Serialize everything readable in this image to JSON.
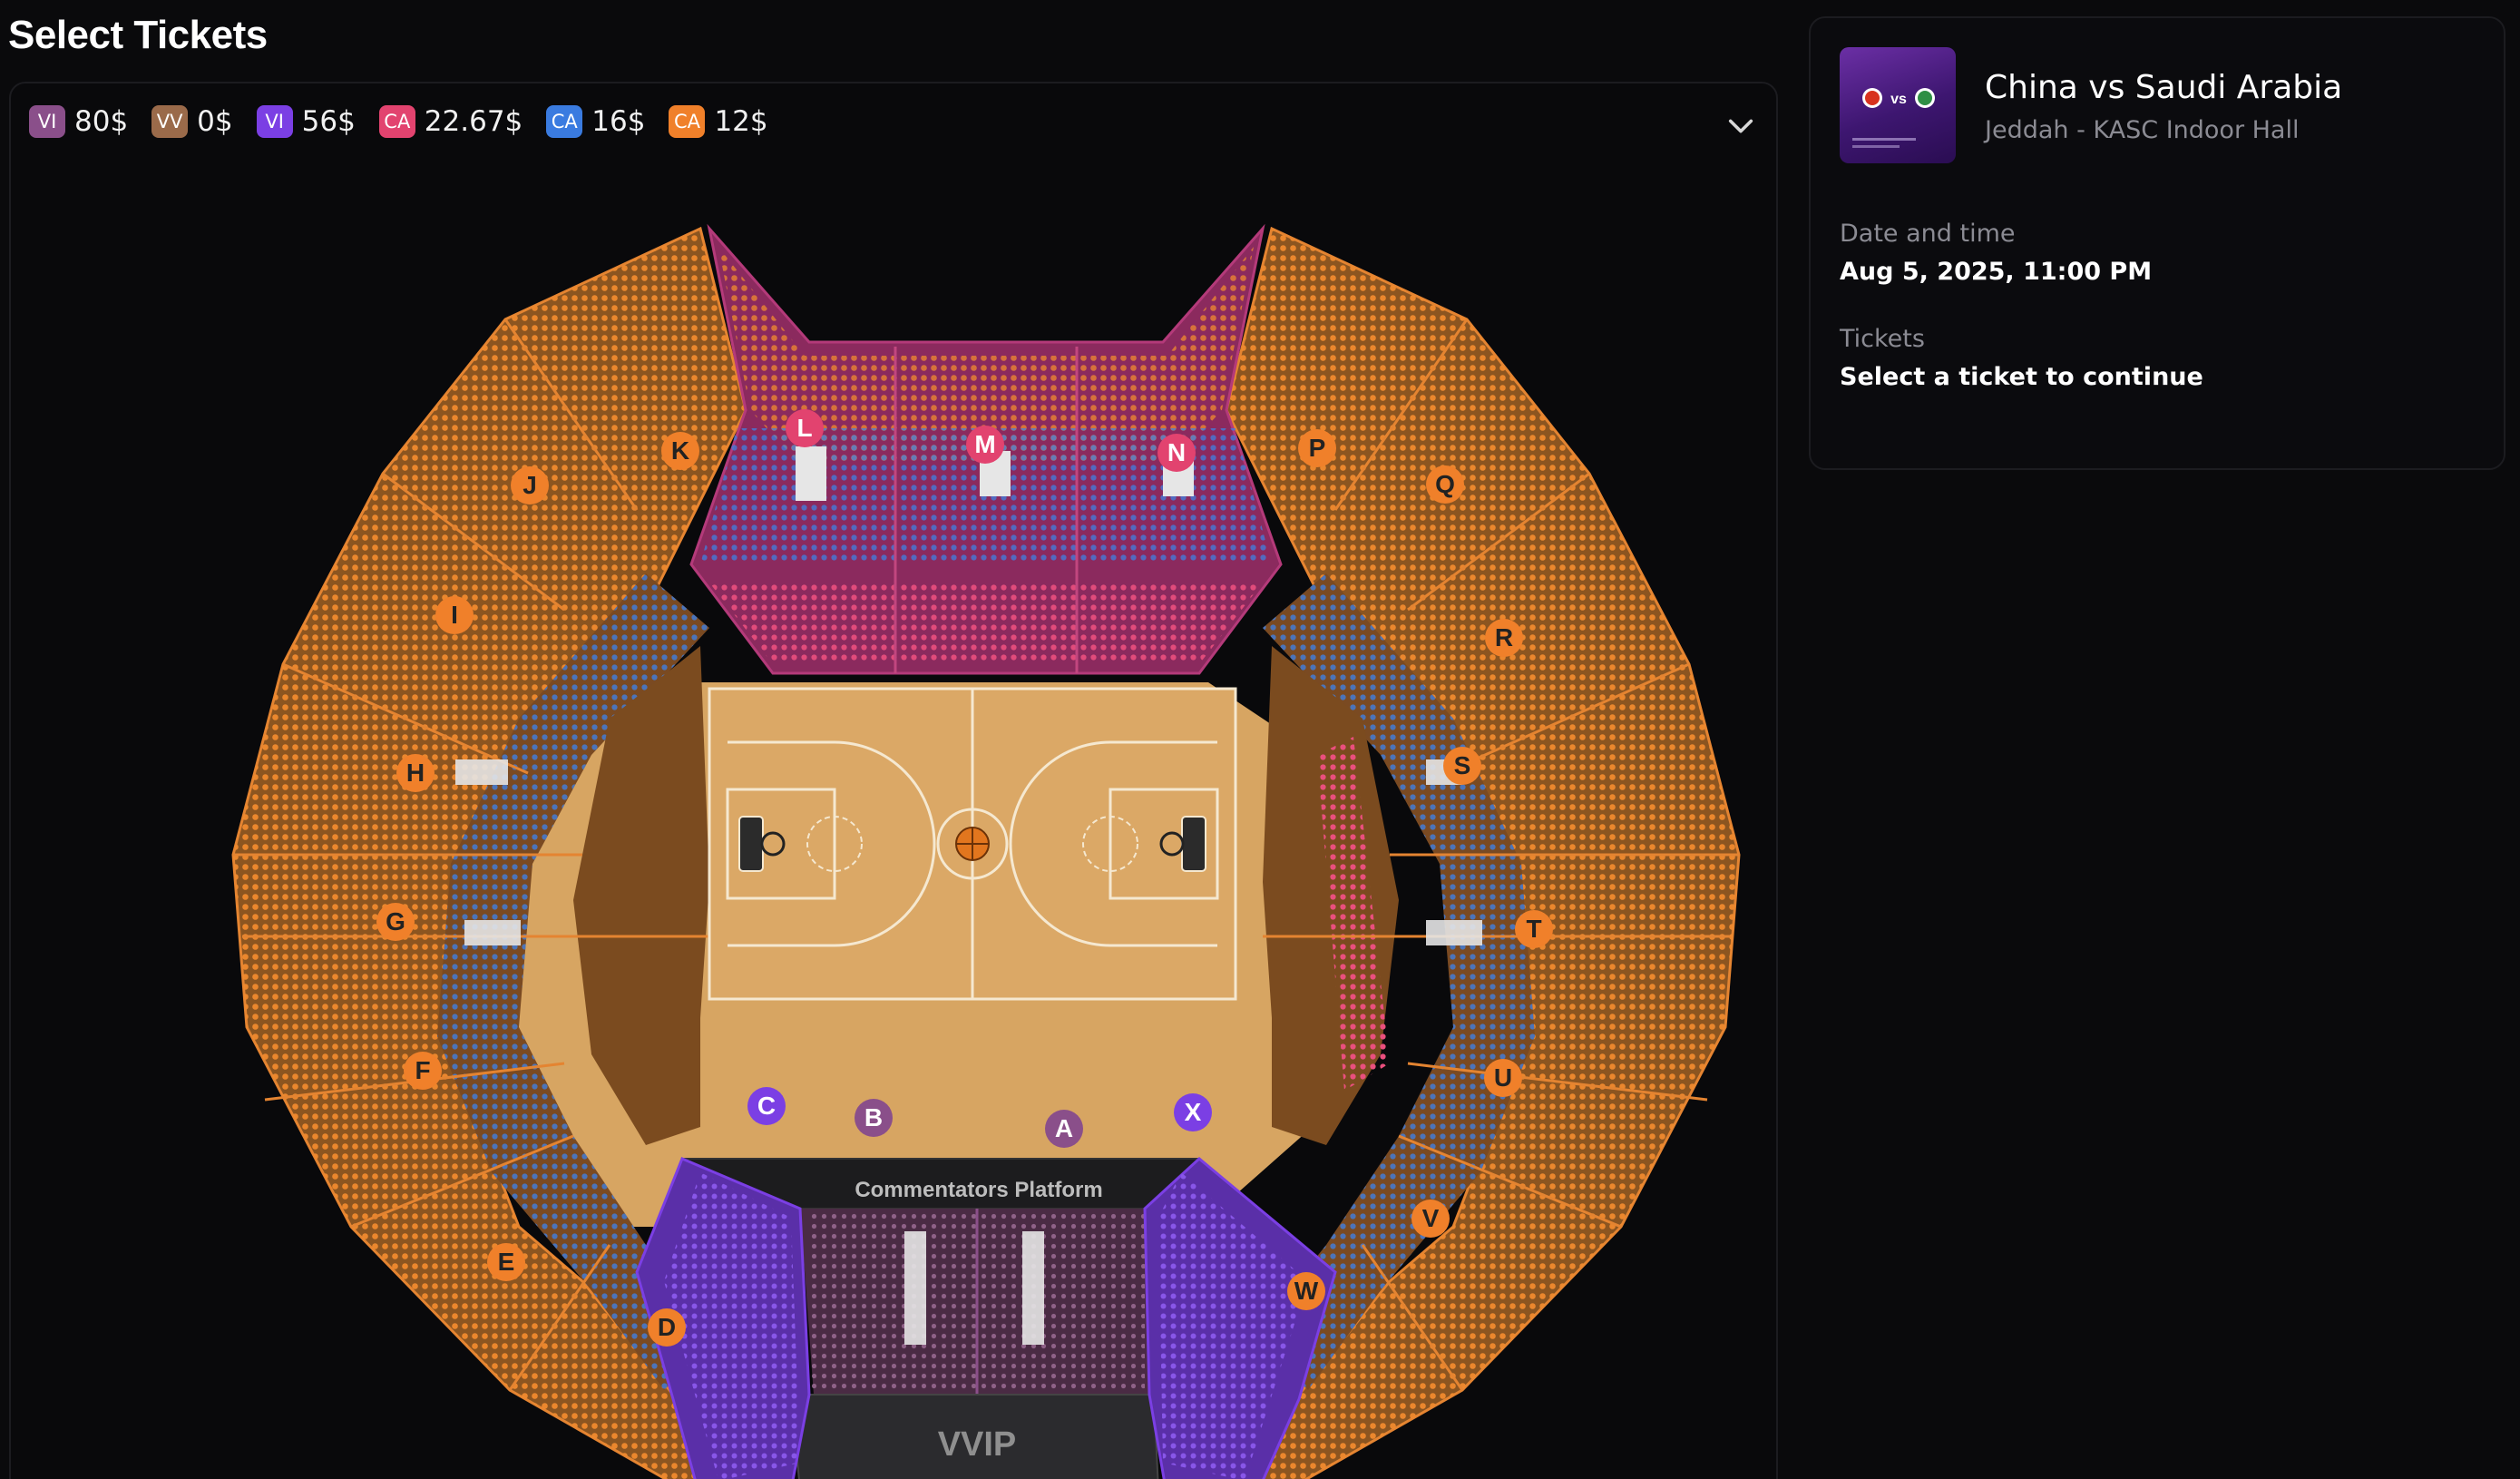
{
  "page": {
    "title": "Select Tickets"
  },
  "legend": [
    {
      "code": "VI",
      "price": "80$",
      "color": "#8a4f8a"
    },
    {
      "code": "VV",
      "price": "0$",
      "color": "#9a6a4a"
    },
    {
      "code": "VI",
      "price": "56$",
      "color": "#7b3fe4"
    },
    {
      "code": "CA",
      "price": "22.67$",
      "color": "#e2436f"
    },
    {
      "code": "CA",
      "price": "16$",
      "color": "#3a7be0"
    },
    {
      "code": "CA",
      "price": "12$",
      "color": "#f0802a"
    }
  ],
  "seat_map": {
    "sections": [
      {
        "label": "A",
        "color": "#8a4f8a"
      },
      {
        "label": "B",
        "color": "#8a4f8a"
      },
      {
        "label": "C",
        "color": "#7b3fe4"
      },
      {
        "label": "D",
        "color": "#f0802a"
      },
      {
        "label": "E",
        "color": "#f0802a"
      },
      {
        "label": "F",
        "color": "#f0802a"
      },
      {
        "label": "G",
        "color": "#f0802a"
      },
      {
        "label": "H",
        "color": "#f0802a"
      },
      {
        "label": "I",
        "color": "#f0802a"
      },
      {
        "label": "J",
        "color": "#f0802a"
      },
      {
        "label": "K",
        "color": "#f0802a"
      },
      {
        "label": "L",
        "color": "#e2436f"
      },
      {
        "label": "M",
        "color": "#e2436f"
      },
      {
        "label": "N",
        "color": "#e2436f"
      },
      {
        "label": "P",
        "color": "#f0802a"
      },
      {
        "label": "Q",
        "color": "#f0802a"
      },
      {
        "label": "R",
        "color": "#f0802a"
      },
      {
        "label": "S",
        "color": "#f0802a"
      },
      {
        "label": "T",
        "color": "#f0802a"
      },
      {
        "label": "U",
        "color": "#f0802a"
      },
      {
        "label": "V",
        "color": "#f0802a"
      },
      {
        "label": "W",
        "color": "#f0802a"
      },
      {
        "label": "X",
        "color": "#7b3fe4"
      }
    ],
    "commentators_label": "Commentators Platform",
    "vvip_label": "VVIP"
  },
  "event": {
    "title": "China vs Saudi Arabia",
    "venue": "Jeddah - KASC Indoor Hall",
    "date_label": "Date and time",
    "date_value": "Aug 5, 2025, 11:00 PM",
    "tickets_label": "Tickets",
    "tickets_value": "Select a ticket to continue",
    "thumbnail_vs": "vs"
  },
  "icons": {
    "collapse": "chevron-down-icon",
    "ball": "basketball-icon",
    "hoop": "basket-hoop-icon"
  }
}
